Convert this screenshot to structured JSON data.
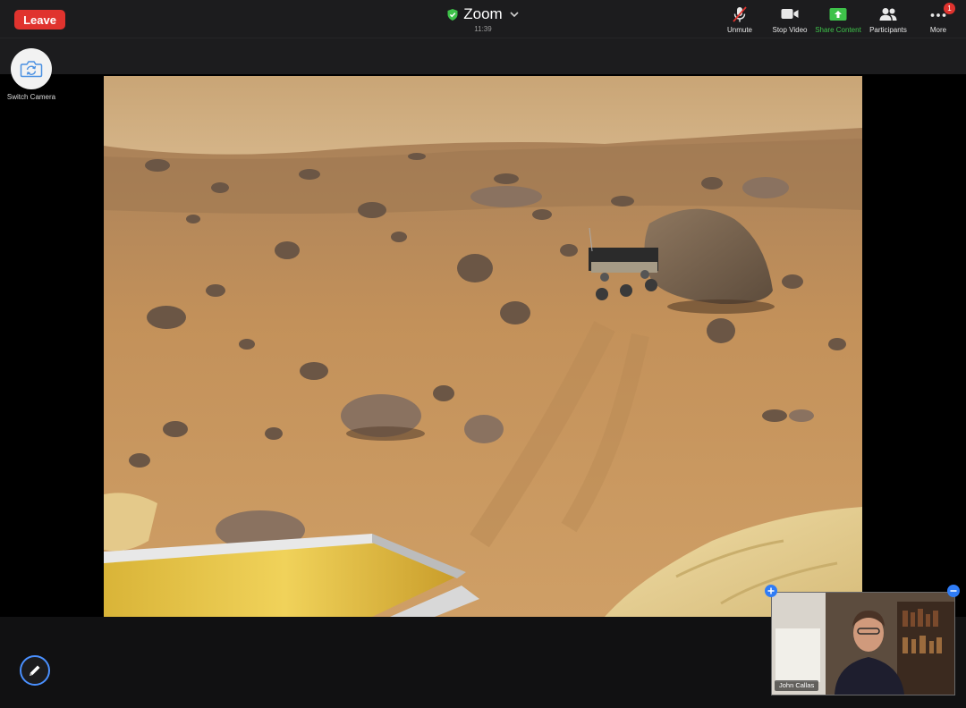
{
  "header": {
    "leave_label": "Leave",
    "app_title": "Zoom",
    "time": "11:39"
  },
  "toolbar": {
    "items": [
      {
        "label": "Unmute",
        "icon": "muted-microphone-icon"
      },
      {
        "label": "Stop Video",
        "icon": "video-camera-icon"
      },
      {
        "label": "Share Content",
        "icon": "share-screen-icon"
      },
      {
        "label": "Participants",
        "icon": "participants-icon"
      },
      {
        "label": "More",
        "icon": "more-dots-icon"
      }
    ],
    "more_badge": "1"
  },
  "camera": {
    "switch_label": "Switch Camera"
  },
  "shared_content": {
    "subject": "Mars surface panorama with rover and lander petals"
  },
  "participant": {
    "name": "John Callas"
  },
  "colors": {
    "leave_red": "#e0332e",
    "share_green": "#3ec24a",
    "accent_blue": "#2f7cf6",
    "bar_bg": "#1c1c1e"
  }
}
